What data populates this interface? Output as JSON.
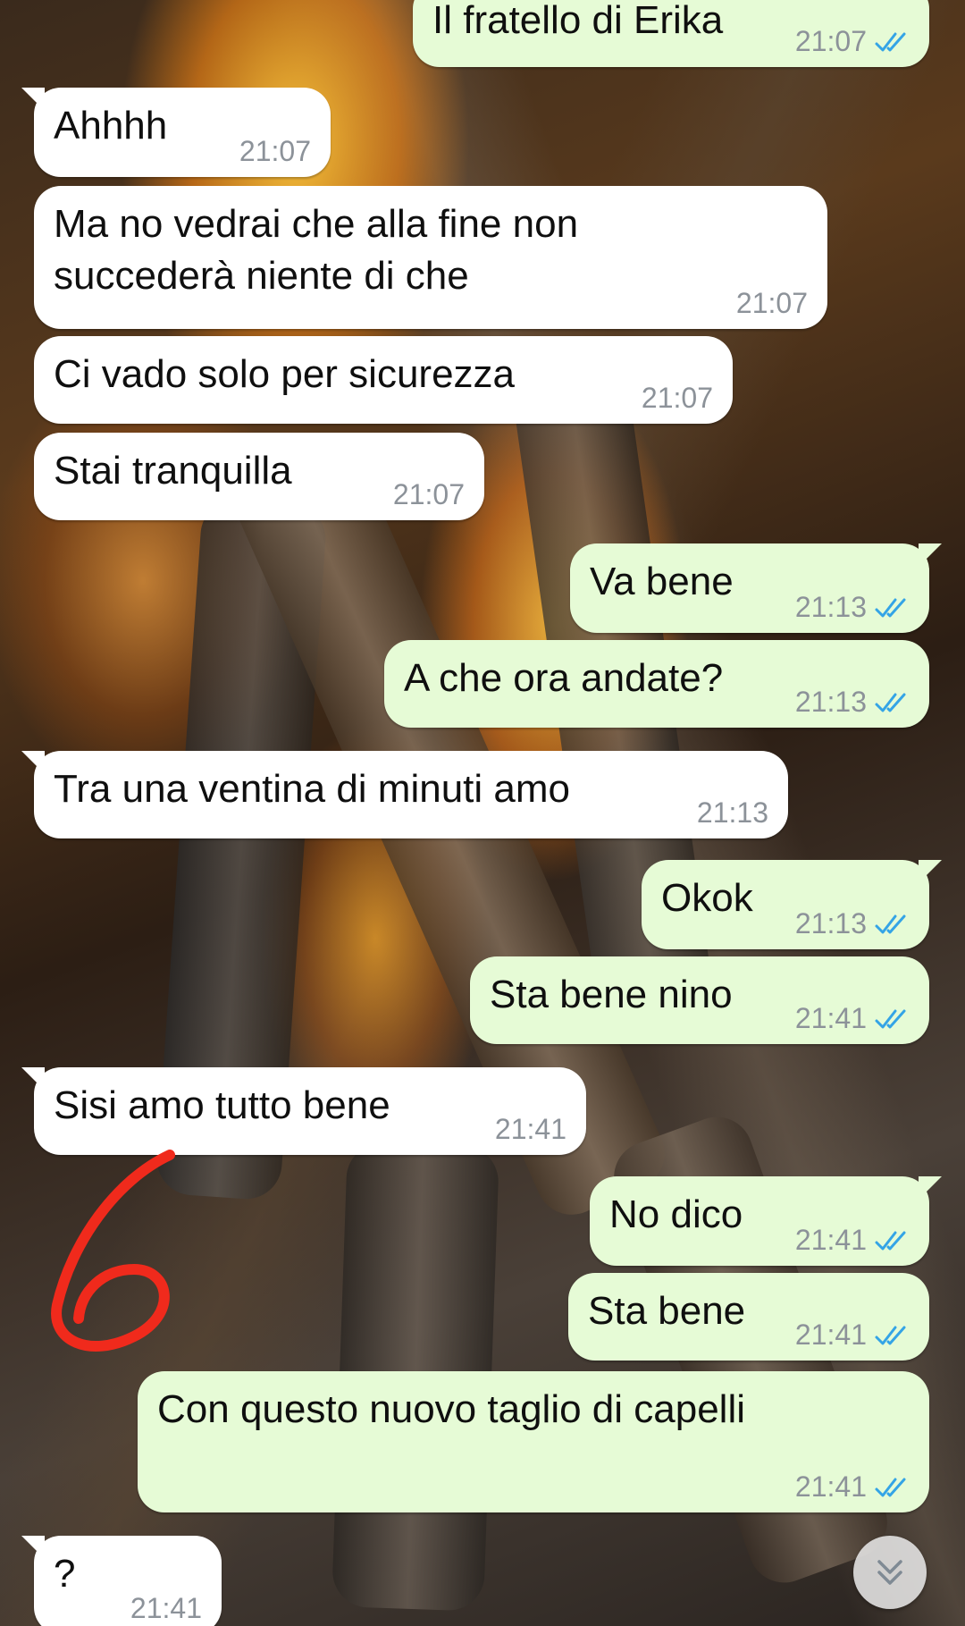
{
  "chat": {
    "messages": [
      {
        "direction": "out",
        "text": "Il fratello di Erika",
        "time": "21:07",
        "read": true
      },
      {
        "direction": "in",
        "text": "Ahhhh",
        "time": "21:07"
      },
      {
        "direction": "in",
        "text": "Ma no vedrai che alla fine non\nsuccederà niente di che",
        "time": "21:07"
      },
      {
        "direction": "in",
        "text": "Ci vado solo per sicurezza",
        "time": "21:07"
      },
      {
        "direction": "in",
        "text": "Stai tranquilla",
        "time": "21:07"
      },
      {
        "direction": "out",
        "text": "Va bene",
        "time": "21:13",
        "read": true
      },
      {
        "direction": "out",
        "text": "A che ora andate?",
        "time": "21:13",
        "read": true
      },
      {
        "direction": "in",
        "text": "Tra una ventina di minuti amo",
        "time": "21:13"
      },
      {
        "direction": "out",
        "text": "Okok",
        "time": "21:13",
        "read": true
      },
      {
        "direction": "out",
        "text": "Sta bene nino",
        "time": "21:41",
        "read": true
      },
      {
        "direction": "in",
        "text": "Sisi amo tutto bene",
        "time": "21:41"
      },
      {
        "direction": "out",
        "text": "No dico",
        "time": "21:41",
        "read": true
      },
      {
        "direction": "out",
        "text": "Sta bene",
        "time": "21:41",
        "read": true
      },
      {
        "direction": "out",
        "text": "Con questo nuovo taglio di capelli",
        "time": "21:41",
        "read": true
      },
      {
        "direction": "in",
        "text": "?",
        "time": "21:41"
      }
    ]
  },
  "colors": {
    "incoming_bubble": "#ffffff",
    "outgoing_bubble": "#e6fbd6",
    "read_ticks": "#34a4e6",
    "timestamp": "#8c9299",
    "annotation": "#f02a1c"
  },
  "icons": {
    "read_receipt": "double-check-icon",
    "scroll_down": "double-chevron-down-icon"
  },
  "annotation": {
    "mark": "6"
  }
}
